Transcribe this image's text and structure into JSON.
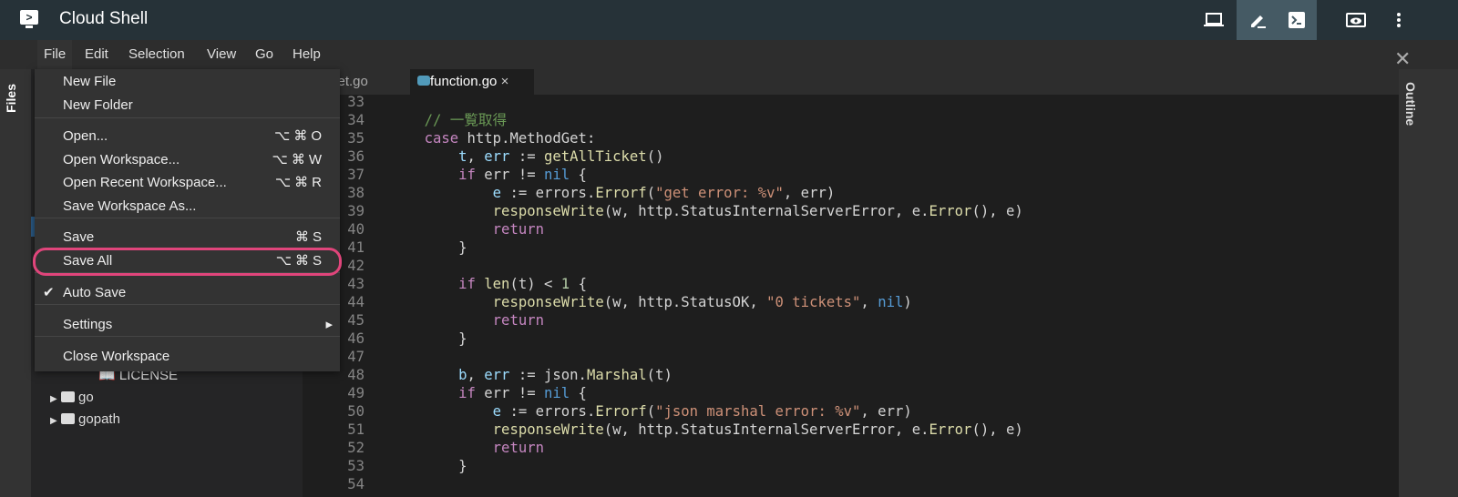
{
  "app": {
    "title": "Cloud Shell"
  },
  "menubar": [
    "File",
    "Edit",
    "Selection",
    "View",
    "Go",
    "Help"
  ],
  "activity": {
    "files": "Files"
  },
  "outline": "Outline",
  "tabs": [
    {
      "label": "ket.go"
    },
    {
      "label": "function.go",
      "close": "×"
    }
  ],
  "file_menu": [
    {
      "label": "New File",
      "shortcut": ""
    },
    {
      "label": "New Folder",
      "shortcut": ""
    },
    {
      "label": "Open...",
      "shortcut": "⌥⌘O"
    },
    {
      "label": "Open Workspace...",
      "shortcut": "⌥⌘W"
    },
    {
      "label": "Open Recent Workspace...",
      "shortcut": "⌥⌘R"
    },
    {
      "label": "Save Workspace As...",
      "shortcut": ""
    },
    {
      "label": "Save",
      "shortcut": "⌘S"
    },
    {
      "label": "Save All",
      "shortcut": "⌥⌘S"
    },
    {
      "label": "Auto Save",
      "shortcut": "",
      "checked": true
    },
    {
      "label": "Settings",
      "shortcut": "▸"
    },
    {
      "label": "Close Workspace",
      "shortcut": ""
    }
  ],
  "tree": [
    {
      "label": "LICENSE"
    },
    {
      "label": "go"
    },
    {
      "label": "gopath"
    }
  ],
  "code": [
    {
      "n": "33",
      "t": []
    },
    {
      "n": "34",
      "t": [
        [
          "p",
          "    "
        ],
        [
          "cm",
          "// 一覧取得"
        ]
      ]
    },
    {
      "n": "35",
      "t": [
        [
          "p",
          "    "
        ],
        [
          "kw",
          "case"
        ],
        [
          "p",
          " http.MethodGet:"
        ]
      ]
    },
    {
      "n": "36",
      "t": [
        [
          "p",
          "        "
        ],
        [
          "var",
          "t"
        ],
        [
          "p",
          ", "
        ],
        [
          "var",
          "err"
        ],
        [
          "p",
          " := "
        ],
        [
          "fn",
          "getAllTicket"
        ],
        [
          "p",
          "()"
        ]
      ]
    },
    {
      "n": "37",
      "t": [
        [
          "p",
          "        "
        ],
        [
          "kw",
          "if"
        ],
        [
          "p",
          " err != "
        ],
        [
          "nil",
          "nil"
        ],
        [
          "p",
          " {"
        ]
      ]
    },
    {
      "n": "38",
      "t": [
        [
          "p",
          "            "
        ],
        [
          "var",
          "e"
        ],
        [
          "p",
          " := errors."
        ],
        [
          "fn",
          "Errorf"
        ],
        [
          "p",
          "("
        ],
        [
          "str",
          "\"get error: %v\""
        ],
        [
          "p",
          ", err)"
        ]
      ]
    },
    {
      "n": "39",
      "t": [
        [
          "p",
          "            "
        ],
        [
          "fn",
          "responseWrite"
        ],
        [
          "p",
          "(w, http.StatusInternalServerError, e."
        ],
        [
          "fn",
          "Error"
        ],
        [
          "p",
          "(), e)"
        ]
      ]
    },
    {
      "n": "40",
      "t": [
        [
          "p",
          "            "
        ],
        [
          "kw",
          "return"
        ]
      ]
    },
    {
      "n": "41",
      "t": [
        [
          "p",
          "        }"
        ]
      ]
    },
    {
      "n": "42",
      "t": []
    },
    {
      "n": "43",
      "t": [
        [
          "p",
          "        "
        ],
        [
          "kw",
          "if"
        ],
        [
          "p",
          " "
        ],
        [
          "fn",
          "len"
        ],
        [
          "p",
          "(t) < "
        ],
        [
          "numc",
          "1"
        ],
        [
          "p",
          " {"
        ]
      ]
    },
    {
      "n": "44",
      "t": [
        [
          "p",
          "            "
        ],
        [
          "fn",
          "responseWrite"
        ],
        [
          "p",
          "(w, http.StatusOK, "
        ],
        [
          "str",
          "\"0 tickets\""
        ],
        [
          "p",
          ", "
        ],
        [
          "nil",
          "nil"
        ],
        [
          "p",
          ")"
        ]
      ]
    },
    {
      "n": "45",
      "t": [
        [
          "p",
          "            "
        ],
        [
          "kw",
          "return"
        ]
      ]
    },
    {
      "n": "46",
      "t": [
        [
          "p",
          "        }"
        ]
      ]
    },
    {
      "n": "47",
      "t": []
    },
    {
      "n": "48",
      "t": [
        [
          "p",
          "        "
        ],
        [
          "var",
          "b"
        ],
        [
          "p",
          ", "
        ],
        [
          "var",
          "err"
        ],
        [
          "p",
          " := json."
        ],
        [
          "fn",
          "Marshal"
        ],
        [
          "p",
          "(t)"
        ]
      ]
    },
    {
      "n": "49",
      "t": [
        [
          "p",
          "        "
        ],
        [
          "kw",
          "if"
        ],
        [
          "p",
          " err != "
        ],
        [
          "nil",
          "nil"
        ],
        [
          "p",
          " {"
        ]
      ]
    },
    {
      "n": "50",
      "t": [
        [
          "p",
          "            "
        ],
        [
          "var",
          "e"
        ],
        [
          "p",
          " := errors."
        ],
        [
          "fn",
          "Errorf"
        ],
        [
          "p",
          "("
        ],
        [
          "str",
          "\"json marshal error: %v\""
        ],
        [
          "p",
          ", err)"
        ]
      ]
    },
    {
      "n": "51",
      "t": [
        [
          "p",
          "            "
        ],
        [
          "fn",
          "responseWrite"
        ],
        [
          "p",
          "(w, http.StatusInternalServerError, e."
        ],
        [
          "fn",
          "Error"
        ],
        [
          "p",
          "(), e)"
        ]
      ]
    },
    {
      "n": "52",
      "t": [
        [
          "p",
          "            "
        ],
        [
          "kw",
          "return"
        ]
      ]
    },
    {
      "n": "53",
      "t": [
        [
          "p",
          "        }"
        ]
      ]
    },
    {
      "n": "54",
      "t": []
    }
  ]
}
